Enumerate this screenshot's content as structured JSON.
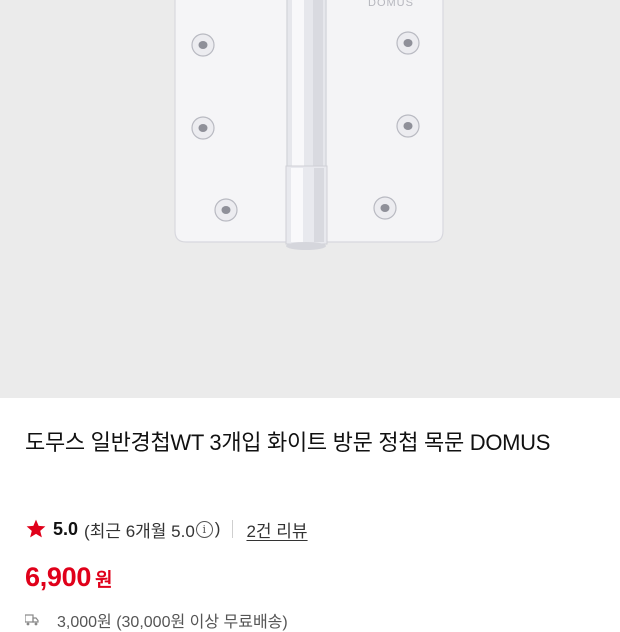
{
  "product": {
    "title": "도무스 일반경첩WT 3개입 화이트 방문 정첩 목문 DOMUS",
    "image_alt": "DOMUS"
  },
  "rating": {
    "score": "5.0",
    "recent_text": "(최근 6개월 5.0",
    "recent_close": ")",
    "review_link": "2건 리뷰"
  },
  "price": {
    "amount": "6,900",
    "currency": "원"
  },
  "shipping": {
    "text": "3,000원 (30,000원 이상 무료배송)"
  },
  "colors": {
    "accent": "#e0001a",
    "image_bg": "#ebebeb"
  }
}
